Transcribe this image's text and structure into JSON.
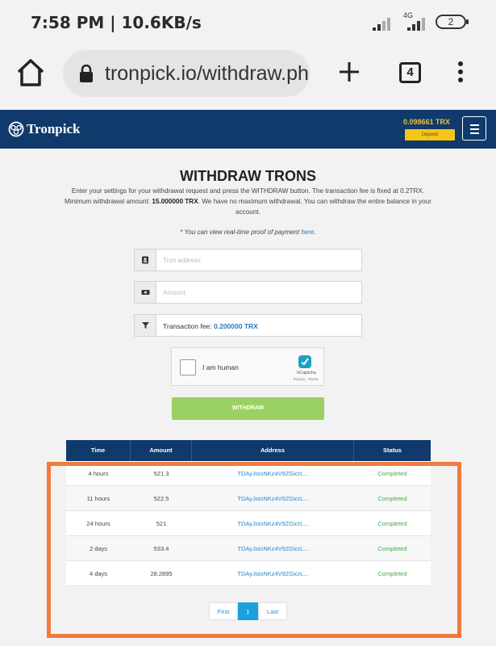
{
  "status_bar": {
    "time": "7:58 PM | 10.6KB/s",
    "network": "4G",
    "battery": "2"
  },
  "browser": {
    "url": "tronpick.io/withdraw.php",
    "tab_count": "4"
  },
  "site": {
    "logo_text": "Tronpick",
    "balance": "0.098661 TRX",
    "deposit_label": "Deposit"
  },
  "page": {
    "title": "WITHDRAW TRONS",
    "intro_line1": "Enter your settings for your withdrawal request and press the WITHDRAW button. The transaction fee is fixed at 0.2TRX.",
    "intro_min_prefix": "Minimum withdrawal amount: ",
    "intro_min_value": "15.000000 TRX",
    "intro_min_suffix": ". We have no maximum withdrawal. You can withdraw the entire balance in your account.",
    "proof_text": "* You can view real-time proof of payment ",
    "proof_link": "here",
    "proof_end": "."
  },
  "form": {
    "address_placeholder": "Tron address",
    "amount_placeholder": "Amount",
    "fee_label": "Transaction fee: ",
    "fee_value": "0.200000 TRX",
    "captcha_label": "I am human",
    "captcha_brand": "hCaptcha",
    "captcha_terms": "Privacy - Terms",
    "withdraw_label": "WITHDRAW"
  },
  "table": {
    "headers": [
      "Time",
      "Amount",
      "Address",
      "Status"
    ],
    "rows": [
      {
        "time": "4 hours",
        "amount": "521.3",
        "address": "TDAyJoisNKz4V9ZGicrL...",
        "status": "Completed"
      },
      {
        "time": "11 hours",
        "amount": "522.5",
        "address": "TDAyJoisNKz4V9ZGicrL...",
        "status": "Completed"
      },
      {
        "time": "24 hours",
        "amount": "521",
        "address": "TDAyJoisNKz4V9ZGicrL...",
        "status": "Completed"
      },
      {
        "time": "2 days",
        "amount": "533.4",
        "address": "TDAyJoisNKz4V9ZGicrL...",
        "status": "Completed"
      },
      {
        "time": "4 days",
        "amount": "28.2895",
        "address": "TDAyJoisNKz4V9ZGicrL...",
        "status": "Completed"
      }
    ]
  },
  "pagination": {
    "first": "First",
    "current": "1",
    "last": "Last"
  },
  "colors": {
    "header_bg": "#103a6b",
    "accent_link": "#2a8ac7",
    "status_ok": "#4aa84a",
    "highlight": "#f07b3f",
    "withdraw_btn": "#9bd163"
  }
}
